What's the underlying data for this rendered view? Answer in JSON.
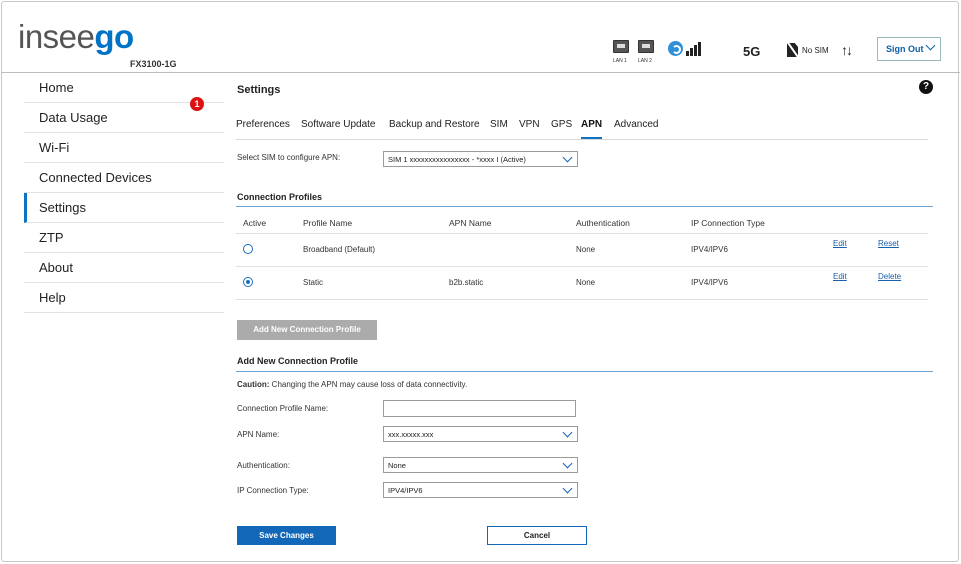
{
  "brand": {
    "logo_prefix": "insee",
    "logo_suffix": "go",
    "model": "FX3100-1G"
  },
  "status": {
    "lan1": "LAN 1",
    "lan2": "LAN 2",
    "network": "5G",
    "sim": "No SIM",
    "data_arrows": "↑↓",
    "signout_label": "Sign Out"
  },
  "sidebar": {
    "items": [
      {
        "label": "Home"
      },
      {
        "label": "Data Usage"
      },
      {
        "label": "Wi-Fi"
      },
      {
        "label": "Connected Devices",
        "badge": "1"
      },
      {
        "label": "Settings",
        "active": true
      },
      {
        "label": "ZTP"
      },
      {
        "label": "About"
      },
      {
        "label": "Help"
      }
    ]
  },
  "page": {
    "title": "Settings",
    "help": "?"
  },
  "tabs": [
    "Preferences",
    "Software Update",
    "Backup and Restore",
    "SIM",
    "VPN",
    "GPS",
    "APN",
    "Advanced"
  ],
  "sim_select": {
    "label": "Select SIM to configure APN:",
    "value": "SIM 1  xxxxxxxxxxxxxxxx - *xxxx  I (Active)"
  },
  "profiles": {
    "title": "Connection Profiles",
    "columns": [
      "Active",
      "Profile Name",
      "APN Name",
      "Authentication",
      "IP Connection Type"
    ],
    "rows": [
      {
        "active": false,
        "profile": "Broadband (Default)",
        "apn": "",
        "auth": "None",
        "ip": "IPV4/IPV6",
        "action1": "Edit",
        "action2": "Reset"
      },
      {
        "active": true,
        "profile": "Static",
        "apn": "b2b.static",
        "auth": "None",
        "ip": "IPV4/IPV6",
        "action1": "Edit",
        "action2": "Delete"
      }
    ],
    "add_button": "Add New Connection Profile"
  },
  "form": {
    "title": "Add New Connection Profile",
    "caution_bold": "Caution:",
    "caution_text": " Changing the APN may cause loss of data connectivity.",
    "profile_name_label": "Connection Profile Name:",
    "profile_name_value": "",
    "apn_label": "APN Name:",
    "apn_value": "xxx.xxxxx.xxx",
    "auth_label": "Authentication:",
    "auth_value": "None",
    "ip_label": "IP Connection Type:",
    "ip_value": "IPV4/IPV6",
    "save_label": "Save Changes",
    "cancel_label": "Cancel"
  },
  "colors": {
    "accent": "#0f73c4",
    "badge": "#dd1111",
    "button_disabled": "#ababab"
  }
}
